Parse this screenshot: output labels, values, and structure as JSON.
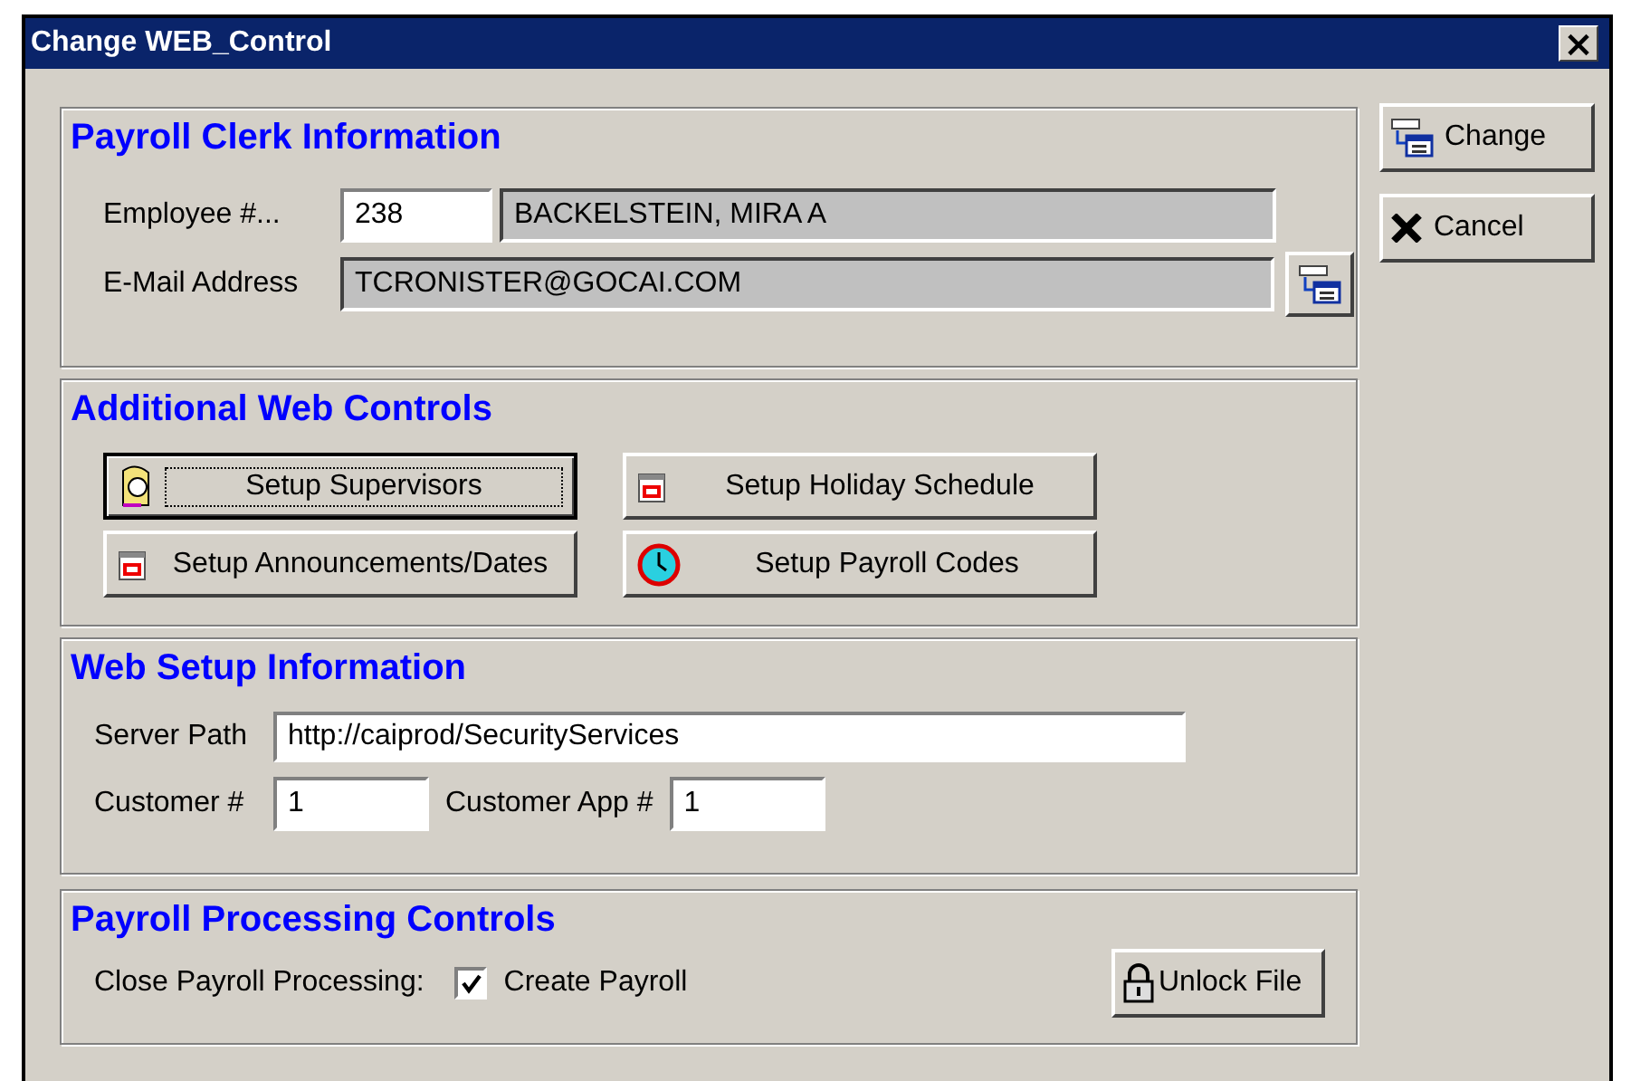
{
  "window": {
    "title": "Change WEB_Control",
    "close": "×"
  },
  "payroll_clerk": {
    "heading": "Payroll Clerk Information",
    "employee_label": "Employee #...",
    "employee_number": "238",
    "employee_name": "BACKELSTEIN, MIRA A",
    "email_label": "E-Mail Address",
    "email": "TCRONISTER@GOCAI.COM"
  },
  "web_controls": {
    "heading": "Additional Web Controls",
    "buttons": [
      {
        "label": "Setup Supervisors",
        "kind": "person",
        "focused": true
      },
      {
        "label": "Setup Holiday Schedule",
        "kind": "calendar",
        "focused": false
      },
      {
        "label": "Setup Announcements/Dates",
        "kind": "calendar",
        "focused": false
      },
      {
        "label": "Setup Payroll Codes",
        "kind": "clock",
        "focused": false
      }
    ]
  },
  "web_setup": {
    "heading": "Web Setup Information",
    "server_path_label": "Server Path",
    "server_path": "http://caiprod/SecurityServices",
    "customer_label": "Customer #",
    "customer": "1",
    "customer_app_label": "Customer App #",
    "customer_app": "1"
  },
  "processing": {
    "heading": "Payroll Processing Controls",
    "close_label": "Close Payroll Processing:",
    "create_payroll": {
      "label": "Create Payroll",
      "checked": true
    },
    "unlock_button": "Unlock File"
  },
  "actions": [
    {
      "label": "Change",
      "kind": "change"
    },
    {
      "label": "Cancel",
      "kind": "cancel"
    }
  ]
}
